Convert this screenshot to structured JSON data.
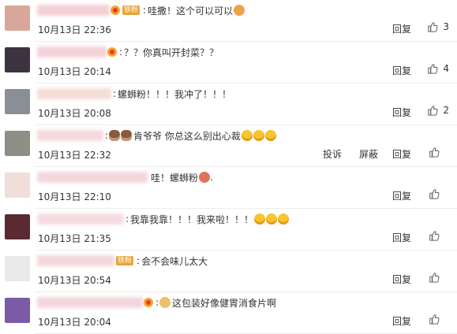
{
  "comments": [
    {
      "name_bar": "#f3c7cf",
      "name_width": 92,
      "avatar_bg": "#d9a79a",
      "badge": "铁粉",
      "has_vip": true,
      "prefix": ":",
      "text": "哇撒！这个可以可以",
      "emojis": [
        "cat-face"
      ],
      "time": "10月13日 22:36",
      "reply": "回复",
      "likes": "3"
    },
    {
      "name_bar": "#f1c9d3",
      "name_width": 88,
      "avatar_bg": "#3b3440",
      "badge": "",
      "has_vip": true,
      "prefix": ":",
      "text": "？？你真叫开封菜？？",
      "emojis": [],
      "time": "10月13日 20:14",
      "reply": "回复",
      "likes": "4"
    },
    {
      "name_bar": "#f2d9cf",
      "name_width": 94,
      "avatar_bg": "#8a8f96",
      "badge": "",
      "has_vip": false,
      "prefix": ":",
      "text": "螺蛳粉！！！我冲了！！！",
      "emojis": [],
      "time": "10月13日 20:08",
      "reply": "回复",
      "likes": "2"
    },
    {
      "name_bar": "#f4d3d9",
      "name_width": 84,
      "avatar_bg": "#8e8e86",
      "badge": "",
      "has_vip": false,
      "prefix": ":",
      "text": "肯爷爷 你总这么别出心裁",
      "emojis": [
        "monkey",
        "monkey",
        "laugh",
        "laugh",
        "laugh"
      ],
      "emoji_after_prefix": 2,
      "time": "10月13日 22:32",
      "report": "投诉",
      "block": "屏蔽",
      "reply": "回复",
      "likes": ""
    },
    {
      "name_bar": "#f3cfd5",
      "name_width": 140,
      "avatar_bg": "#f0ded8",
      "badge": "",
      "has_vip": false,
      "prefix": "",
      "text": "哇！螺蛳粉",
      "text_suffix": ".",
      "emojis": [
        "face-red"
      ],
      "time": "10月13日 22:10",
      "reply": "回复",
      "likes": ""
    },
    {
      "name_bar": "#f5d5dc",
      "name_width": 110,
      "avatar_bg": "#5a2a32",
      "badge": "",
      "has_vip": false,
      "prefix": ":",
      "text": "我靠我靠！！！我来啦！！！",
      "emojis": [
        "heart-eyes",
        "heart-eyes",
        "heart-eyes"
      ],
      "time": "10月13日 21:35",
      "reply": "回复",
      "likes": ""
    },
    {
      "name_bar": "#f2d0d6",
      "name_width": 98,
      "avatar_bg": "#e9e9e9",
      "badge": "铁粉",
      "has_vip": false,
      "prefix": ":",
      "text": "会不会味儿太大",
      "emojis": [],
      "time": "10月13日 20:54",
      "reply": "回复",
      "likes": ""
    },
    {
      "name_bar": "#f3cfd6",
      "name_width": 134,
      "avatar_bg": "#7b5aa6",
      "badge": "",
      "has_vip": true,
      "prefix": ":",
      "text": "这包装好像健胃消食片啊",
      "emojis": [
        "doge"
      ],
      "emoji_first": true,
      "time": "10月13日 20:04",
      "reply": "回复",
      "likes": ""
    }
  ],
  "colors": {
    "cat-face": "#f0a24a",
    "monkey": "#8a5a3c",
    "laugh": "#f7c531",
    "face-red": "#e0735e",
    "heart-eyes": "#f7c531",
    "doge": "#e9c16b"
  }
}
